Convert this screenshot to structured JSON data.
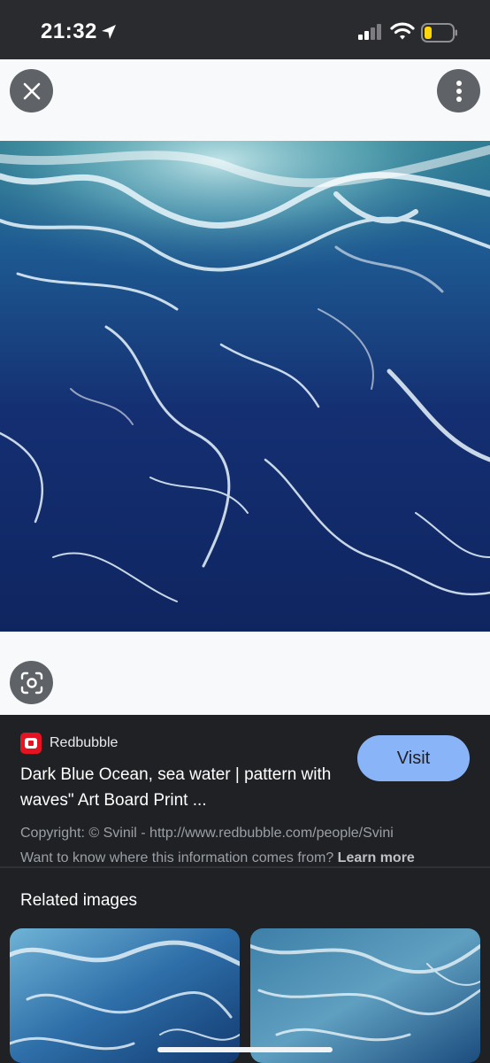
{
  "status_bar": {
    "time": "21:32",
    "icons": [
      "location-arrow-icon",
      "cellular-signal-icon",
      "wifi-icon",
      "battery-low-icon"
    ],
    "battery_color": "#ffd60a"
  },
  "viewer": {
    "background": "#f8f9fa",
    "image_subject": "ocean-waves-image",
    "buttons": [
      "close-icon",
      "more-vert-icon",
      "google-lens-icon"
    ]
  },
  "result": {
    "source": "Redbubble",
    "title": "Dark Blue Ocean, sea water | pattern with waves\" Art Board Print ...",
    "visit_label": "Visit",
    "copyright": "Copyright: © Svinil - http://www.redbubble.com/people/Svini",
    "info_prefix": "Want to know where this information comes from?",
    "learn_more": "Learn more"
  },
  "related": {
    "heading": "Related images",
    "thumbnails": [
      "related-ocean-thumbnail-1",
      "related-ocean-thumbnail-2"
    ]
  },
  "colors": {
    "accent": "#8ab4f8",
    "background_dark": "#202124",
    "favicon_red": "#e41321"
  }
}
